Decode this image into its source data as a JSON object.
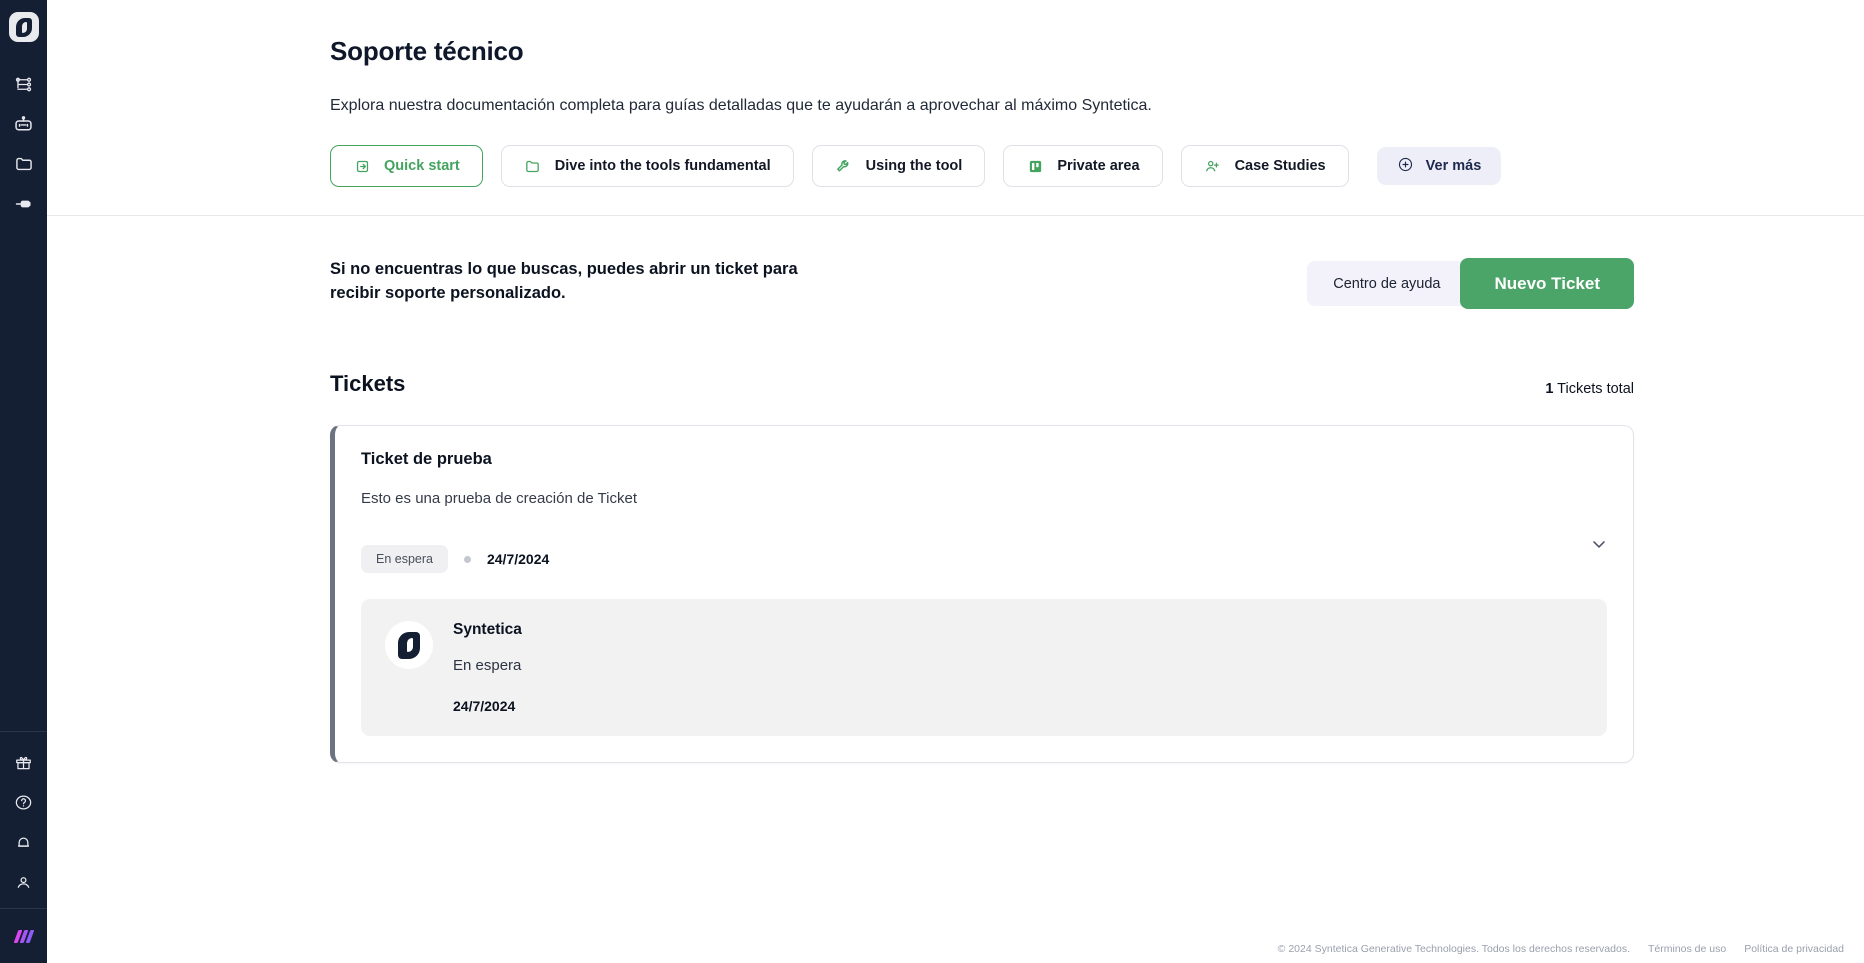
{
  "sidebar": {
    "logo_name": "Syntetica",
    "items": [
      {
        "name": "workflow",
        "label": "Workflow"
      },
      {
        "name": "robot",
        "label": "Agents"
      },
      {
        "name": "folder",
        "label": "Files"
      },
      {
        "name": "plug",
        "label": "Integrations"
      }
    ],
    "bottom_items": [
      {
        "name": "gift",
        "label": "Rewards"
      },
      {
        "name": "help",
        "label": "Help"
      },
      {
        "name": "bell",
        "label": "Notifications"
      },
      {
        "name": "user",
        "label": "Account"
      }
    ],
    "footer_logo_colors": [
      "#d946ef",
      "#a855f7",
      "#8b5cf6"
    ]
  },
  "page": {
    "title": "Soporte técnico",
    "subtitle": "Explora nuestra documentación completa para guías detalladas que te ayudarán a aprovechar al máximo Syntetica."
  },
  "quick_links": [
    {
      "label": "Quick start",
      "icon": "login-icon",
      "active": true
    },
    {
      "label": "Dive into the tools fundamental",
      "icon": "folder-icon",
      "active": false
    },
    {
      "label": "Using the tool",
      "icon": "wrench-icon",
      "active": false
    },
    {
      "label": "Private area",
      "icon": "board-icon",
      "active": false
    },
    {
      "label": "Case Studies",
      "icon": "user-plus-icon",
      "active": false
    }
  ],
  "see_more": {
    "label": "Ver más",
    "icon": "plus-circle-icon"
  },
  "cta": {
    "text_line1": "Si no encuentras lo que buscas, puedes abrir un ticket para",
    "text_line2": "recibir soporte personalizado.",
    "help_center_label": "Centro de ayuda",
    "new_ticket_label": "Nuevo Ticket"
  },
  "tickets_section": {
    "title": "Tickets",
    "total_count": "1",
    "total_label": "Tickets total"
  },
  "ticket": {
    "title": "Ticket de prueba",
    "description": "Esto es una prueba de creación de Ticket",
    "status": "En espera",
    "date": "24/7/2024",
    "reply": {
      "author": "Syntetica",
      "status": "En espera",
      "date": "24/7/2024"
    }
  },
  "footer": {
    "copyright": "© 2024 Syntetica Generative Technologies. Todos los derechos reservados.",
    "terms": "Términos de uso",
    "privacy": "Política de privacidad"
  },
  "colors": {
    "accent_green": "#4ca568",
    "sidebar_bg": "#141f33",
    "lavender": "#eeeef8"
  }
}
